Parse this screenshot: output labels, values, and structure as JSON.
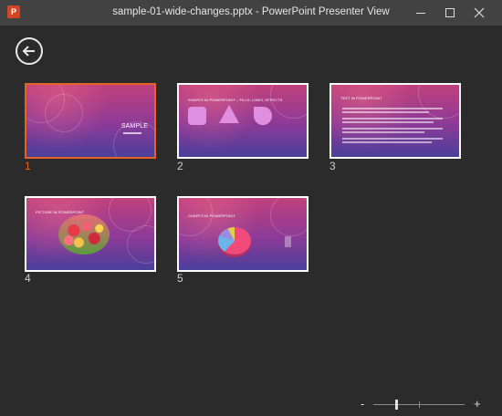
{
  "window": {
    "title": "sample-01-wide-changes.pptx - PowerPoint Presenter View",
    "app_icon_label": "P",
    "controls": [
      "minimize",
      "maximize",
      "close"
    ]
  },
  "back_button": {
    "icon": "back-arrow-icon"
  },
  "slides": [
    {
      "number": "1",
      "selected": true,
      "title": "SAMPLE"
    },
    {
      "number": "2",
      "selected": false,
      "title": "SHAPES IN POWERPOINT – FILLS, LINES, EFFECTS"
    },
    {
      "number": "3",
      "selected": false,
      "title": "TEXT IN POWERPOINT"
    },
    {
      "number": "4",
      "selected": false,
      "title": "PICTURE IN POWERPOINT"
    },
    {
      "number": "5",
      "selected": false,
      "title": "CHARTS IN POWERPOINT"
    }
  ],
  "zoom": {
    "minus_label": "-",
    "plus_label": "+",
    "level": 0.25
  },
  "colors": {
    "background": "#2b2b2b",
    "titlebar": "#424242",
    "accent": "#e66325"
  }
}
